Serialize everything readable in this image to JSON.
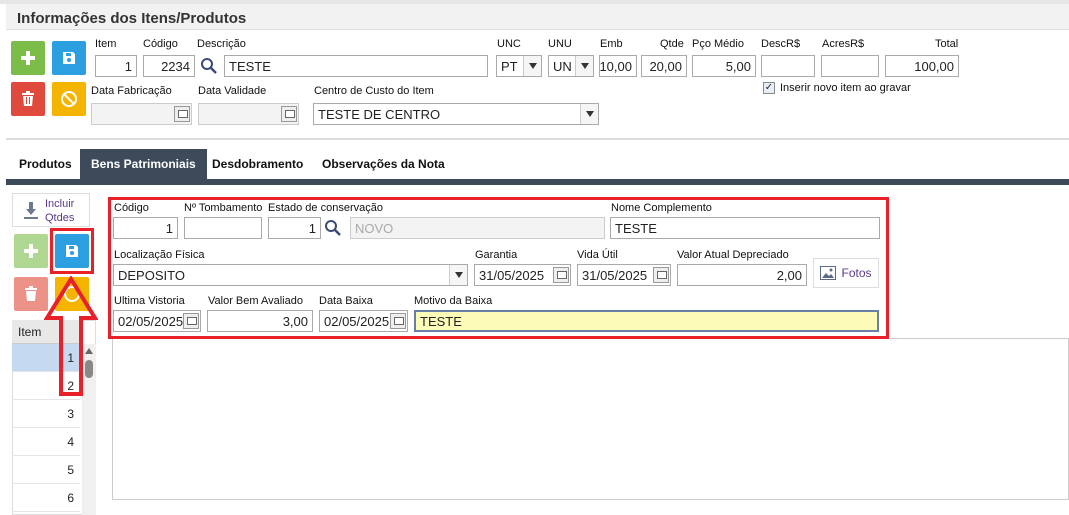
{
  "header": {
    "title": "Informações dos Itens/Produtos"
  },
  "item_form": {
    "labels": {
      "item": "Item",
      "codigo": "Código",
      "descricao": "Descrição",
      "unc": "UNC",
      "unu": "UNU",
      "emb": "Emb",
      "qtde": "Qtde",
      "pco_medio": "Pço Médio",
      "desc": "DescR$",
      "acres": "AcresR$",
      "total": "Total",
      "data_fabricacao": "Data Fabricação",
      "data_validade": "Data Validade",
      "centro_custo": "Centro de Custo do Item",
      "inserir_novo": "Inserir novo item ao gravar"
    },
    "values": {
      "item": "1",
      "codigo": "2234",
      "descricao": "TESTE",
      "unc": "PT",
      "unu": "UN",
      "emb": "10,00",
      "qtde": "20,00",
      "pco_medio": "5,00",
      "desc": "",
      "acres": "",
      "total": "100,00",
      "data_fabricacao": "",
      "data_validade": "",
      "centro_custo": "TESTE DE CENTRO",
      "inserir_novo": true
    }
  },
  "tabs": [
    {
      "label": "Produtos",
      "active": false
    },
    {
      "label": "Bens Patrimoniais",
      "active": true
    },
    {
      "label": "Desdobramento",
      "active": false
    },
    {
      "label": "Observações da Nota",
      "active": false
    }
  ],
  "side": {
    "incluir_label": "Incluir Qtdes",
    "grid_header": "Item",
    "rows": [
      "1",
      "2",
      "3",
      "4",
      "5",
      "6"
    ]
  },
  "bens": {
    "labels": {
      "codigo": "Código",
      "tombamento": "Nº Tombamento",
      "estado": "Estado de conservação",
      "nome_complemento": "Nome Complemento",
      "localizacao": "Localização Física",
      "garantia": "Garantia",
      "vida_util": "Vida Útil",
      "valor_atual": "Valor Atual Depreciado",
      "fotos": "Fotos",
      "ultima_vistoria": "Ultima Vistoria",
      "valor_bem": "Valor Bem Avaliado",
      "data_baixa": "Data Baixa",
      "motivo_baixa": "Motivo da Baixa"
    },
    "values": {
      "codigo": "1",
      "tombamento": "",
      "estado_codigo": "1",
      "estado_descricao": "NOVO",
      "nome_complemento": "TESTE",
      "localizacao": "DEPOSITO",
      "garantia": "31/05/2025",
      "vida_util": "31/05/2025",
      "valor_atual": "2,00",
      "ultima_vistoria": "02/05/2025",
      "valor_bem": "3,00",
      "data_baixa": "02/05/2025",
      "motivo_baixa": "TESTE"
    }
  },
  "colors": {
    "accent_dark": "#3c4a59",
    "highlight": "#e8202a",
    "green": "#7cbd4a",
    "blue": "#2c9fe0",
    "red": "#e04a3c",
    "yellow": "#f4b400"
  }
}
